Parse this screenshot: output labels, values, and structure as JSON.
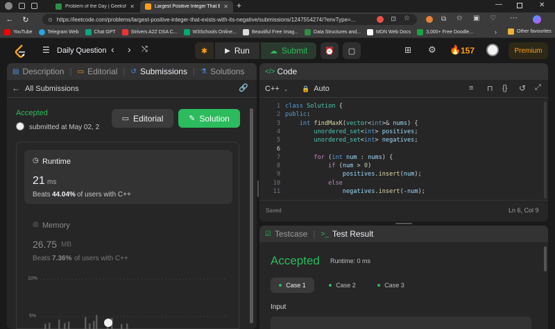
{
  "browser": {
    "tabs": [
      {
        "title": "Problem of the Day | GeeksforGe",
        "active": false
      },
      {
        "title": "Largest Positive Integer That Exis",
        "active": true
      }
    ],
    "url": "https://leetcode.com/problems/largest-positive-integer-that-exists-with-its-negative/submissions/1247554274/?envType=...",
    "bookmarks": [
      "YouTube",
      "Telegram Web",
      "Chat GPT",
      "Strivers A2Z DSA C...",
      "W3Schools Online...",
      "Beautiful Free Imag...",
      "Data Structures and...",
      "MDN Web Docs",
      "3,000+ Free Doodle..."
    ],
    "other_favorites": "Other favourites"
  },
  "header": {
    "question_label": "Daily Question",
    "run_label": "Run",
    "submit_label": "Submit",
    "streak": "157",
    "premium_label": "Premium"
  },
  "left_tabs": [
    "Description",
    "Editorial",
    "Submissions",
    "Solutions"
  ],
  "submission": {
    "back_label": "All Submissions",
    "status": "Accepted",
    "submitted_at": "submitted at May 02, 2",
    "editorial_btn": "Editorial",
    "solution_btn": "Solution",
    "runtime": {
      "title": "Runtime",
      "value": "21",
      "unit": "ms",
      "beats_prefix": "Beats",
      "beats_value": "44.04%",
      "beats_suffix": "of users with C++"
    },
    "memory": {
      "title": "Memory",
      "value": "26.75",
      "unit": "MB",
      "beats_prefix": "Beats",
      "beats_value": "7.36%",
      "beats_suffix": "of users with C++"
    },
    "chart_labels": [
      "10%",
      "5%"
    ]
  },
  "chart_data": {
    "type": "bar",
    "title": "",
    "xlabel": "",
    "ylabel": "",
    "ylim": [
      0,
      10
    ],
    "yticks": [
      "10%",
      "5%"
    ],
    "values": [
      0.4,
      0.8,
      2.0,
      0.6,
      1.2,
      3.0,
      0.5,
      1.5,
      3.8,
      0.6,
      2.6,
      0.3,
      0.5
    ]
  },
  "code_panel": {
    "title": "Code",
    "language": "C++",
    "mode": "Auto",
    "saved": "Saved",
    "cursor": "Ln 6, Col 9",
    "lines": [
      {
        "n": "1",
        "html": "<span class=\"kb\">class</span> <span class=\"ty\">Solution</span> {"
      },
      {
        "n": "2",
        "html": "<span class=\"kb\">public</span>:"
      },
      {
        "n": "3",
        "html": "    <span class=\"kb\">int</span> <span class=\"fn\">findMaxK</span>(<span class=\"ty\">vector</span>&lt;<span class=\"kb\">int</span>&gt;&amp; <span class=\"vr\">nums</span>) {"
      },
      {
        "n": "4",
        "html": "        <span class=\"ty\">unordered_set</span>&lt;<span class=\"kb\">int</span>&gt; <span class=\"vr\">positives</span>;"
      },
      {
        "n": "5",
        "html": "        <span class=\"ty\">unordered_set</span>&lt;<span class=\"kb\">int</span>&gt; <span class=\"vr\">negatives</span>;"
      },
      {
        "n": "6",
        "html": ""
      },
      {
        "n": "7",
        "html": "        <span class=\"kw\">for</span> (<span class=\"kb\">int</span> <span class=\"vr\">num</span> : <span class=\"vr\">nums</span>) {"
      },
      {
        "n": "8",
        "html": "            <span class=\"kw\">if</span> (<span class=\"vr\">num</span> &gt; <span class=\"nm\">0</span>)"
      },
      {
        "n": "9",
        "html": "                <span class=\"vr\">positives</span>.<span class=\"fn\">insert</span>(<span class=\"vr\">num</span>);"
      },
      {
        "n": "10",
        "html": "            <span class=\"kw\">else</span>"
      },
      {
        "n": "11",
        "html": "                <span class=\"vr\">negatives</span>.<span class=\"fn\">insert</span>(-<span class=\"vr\">num</span>);"
      }
    ]
  },
  "result_panel": {
    "tab_testcase": "Testcase",
    "tab_result": "Test Result",
    "status": "Accepted",
    "runtime": "Runtime: 0 ms",
    "cases": [
      "Case 1",
      "Case 2",
      "Case 3"
    ],
    "input_label": "Input"
  },
  "colors": {
    "accent_green": "#2cbb5d",
    "accent_orange": "#ffa116",
    "panel": "#262626",
    "bg": "#1a1a1a"
  }
}
